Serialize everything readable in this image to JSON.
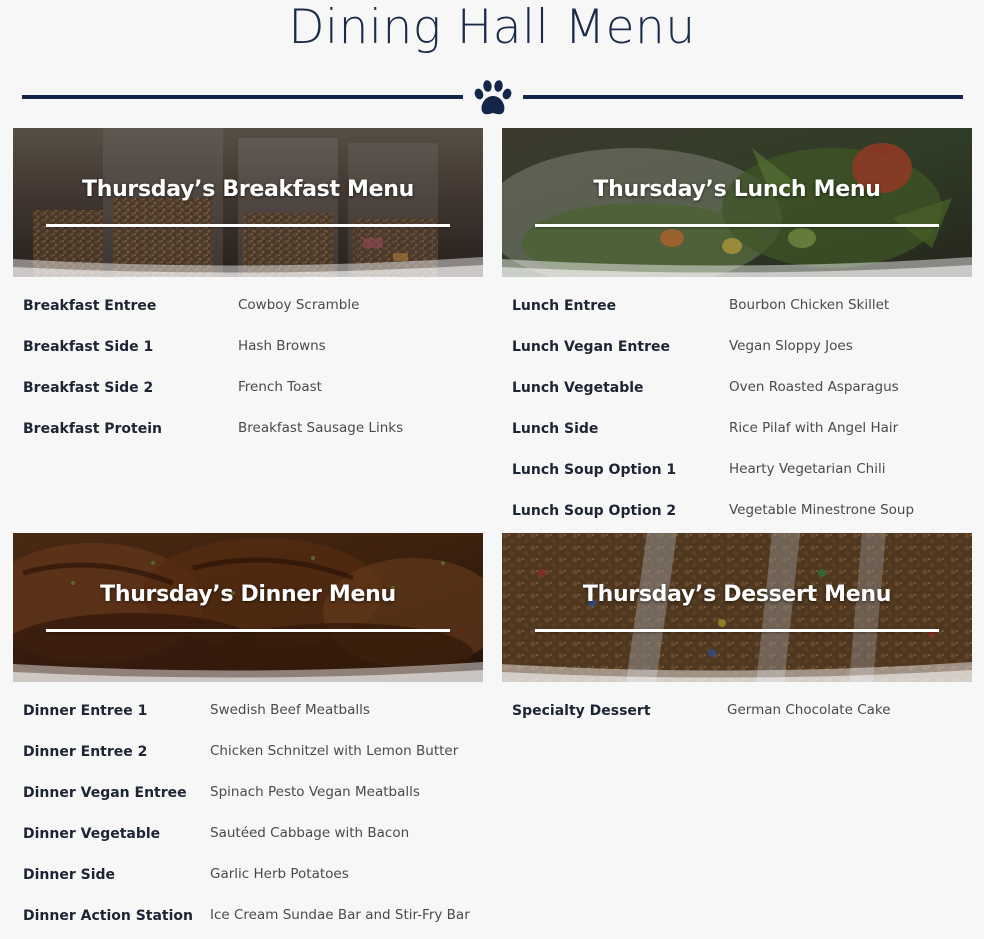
{
  "page": {
    "title": "Dining Hall Menu",
    "accent_color": "#14254a",
    "divider_icon": "paw-icon"
  },
  "menus": {
    "breakfast": {
      "title": "Thursday’s Breakfast Menu",
      "image": "cereal-dispensers",
      "items": [
        {
          "label": "Breakfast Entree",
          "value": "Cowboy Scramble"
        },
        {
          "label": "Breakfast Side 1",
          "value": "Hash Browns"
        },
        {
          "label": "Breakfast Side 2",
          "value": "French Toast"
        },
        {
          "label": "Breakfast Protein",
          "value": "Breakfast Sausage Links"
        }
      ]
    },
    "lunch": {
      "title": "Thursday’s Lunch Menu",
      "image": "salad-bowl",
      "items": [
        {
          "label": "Lunch Entree",
          "value": "Bourbon Chicken Skillet"
        },
        {
          "label": "Lunch Vegan Entree",
          "value": "Vegan Sloppy Joes"
        },
        {
          "label": "Lunch Vegetable",
          "value": "Oven Roasted Asparagus"
        },
        {
          "label": "Lunch Side",
          "value": "Rice Pilaf with Angel Hair"
        },
        {
          "label": "Lunch Soup Option 1",
          "value": "Hearty Vegetarian Chili"
        },
        {
          "label": "Lunch Soup Option 2",
          "value": "Vegetable Minestrone Soup"
        }
      ]
    },
    "dinner": {
      "title": "Thursday’s Dinner Menu",
      "image": "grilled-chicken",
      "items": [
        {
          "label": "Dinner Entree 1",
          "value": "Swedish Beef Meatballs"
        },
        {
          "label": "Dinner Entree 2",
          "value": "Chicken Schnitzel with Lemon Butter"
        },
        {
          "label": "Dinner Vegan Entree",
          "value": "Spinach Pesto Vegan Meatballs"
        },
        {
          "label": "Dinner Vegetable",
          "value": "Sautéed Cabbage with Bacon"
        },
        {
          "label": "Dinner Side",
          "value": "Garlic Herb Potatoes"
        },
        {
          "label": "Dinner Action Station",
          "value": "Ice Cream Sundae Bar and Stir-Fry Bar"
        }
      ]
    },
    "dessert": {
      "title": "Thursday’s Dessert Menu",
      "image": "cookie-bars",
      "items": [
        {
          "label": "Specialty Dessert",
          "value": "German Chocolate Cake"
        }
      ]
    }
  }
}
